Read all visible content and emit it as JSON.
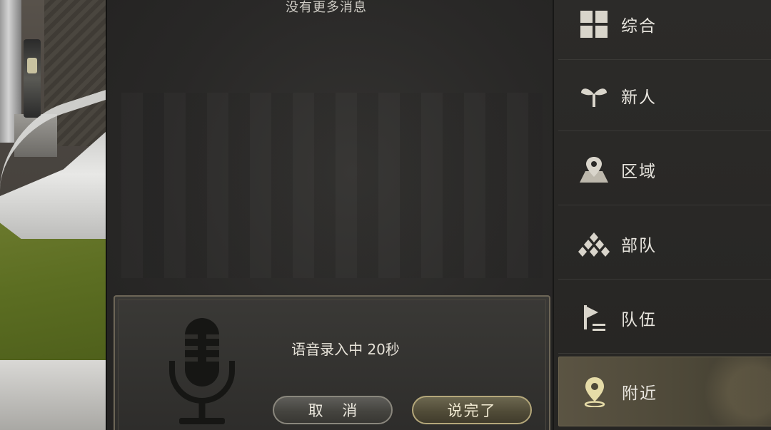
{
  "chat": {
    "no_more_messages": "没有更多消息"
  },
  "voice_dialog": {
    "recording_status": "语音录入中 20秒",
    "cancel_label": "取 消",
    "done_label": "说完了"
  },
  "sidebar": {
    "tabs": [
      {
        "label": "综合",
        "icon": "grid-icon",
        "active": false
      },
      {
        "label": "新人",
        "icon": "sprout-icon",
        "active": false
      },
      {
        "label": "区域",
        "icon": "map-pin-icon",
        "active": false
      },
      {
        "label": "部队",
        "icon": "company-icon",
        "active": false
      },
      {
        "label": "队伍",
        "icon": "party-flag-icon",
        "active": false
      },
      {
        "label": "附近",
        "icon": "location-pin-icon",
        "active": true
      }
    ]
  },
  "colors": {
    "panel_bg": "#292827",
    "accent_gold": "#b4a77a",
    "text_light": "#e9e6df",
    "active_tab": "#5b5443"
  }
}
